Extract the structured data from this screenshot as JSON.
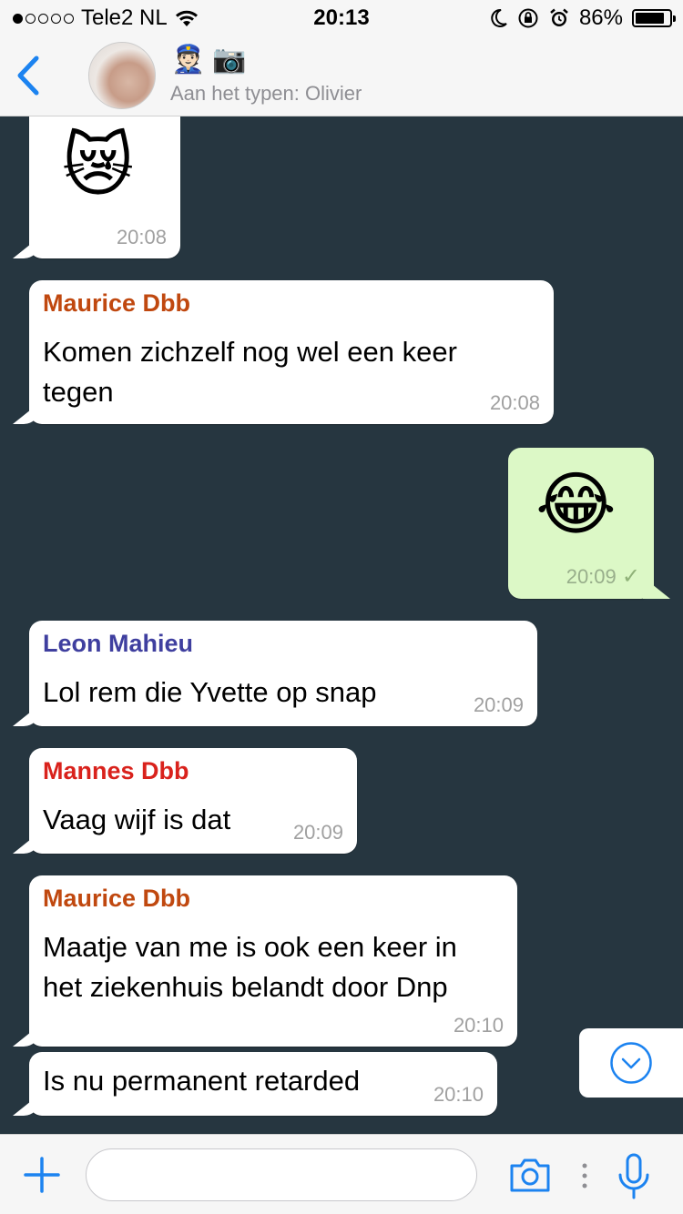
{
  "status_bar": {
    "carrier": "Tele2 NL",
    "time": "20:13",
    "battery": "86%",
    "battery_level": 0.86,
    "signal_bars": 1
  },
  "header": {
    "back_icon": "chevron-left-icon",
    "group_emoji": [
      "👮🏻",
      "📷"
    ],
    "typing_status": "Aan het typen: Olivier"
  },
  "messages": [
    {
      "direction": "in",
      "emoji": "😿",
      "time": "20:08"
    },
    {
      "direction": "in",
      "sender": "Maurice Dbb",
      "sender_color": "#c0480f",
      "text_lines": [
        "Komen zichzelf nog wel een keer",
        "tegen"
      ],
      "time": "20:08"
    },
    {
      "direction": "out",
      "emoji": "😂",
      "time": "20:09",
      "status": "✓"
    },
    {
      "direction": "in",
      "sender": "Leon Mahieu",
      "sender_color": "#3f3f9f",
      "text": "Lol rem die Yvette op snap",
      "time": "20:09"
    },
    {
      "direction": "in",
      "sender": "Mannes Dbb",
      "sender_color": "#d9221c",
      "text": "Vaag wijf is dat",
      "time": "20:09"
    },
    {
      "direction": "in",
      "sender": "Maurice Dbb",
      "sender_color": "#c0480f",
      "text_lines": [
        "Maatje van me is ook een keer in",
        "het ziekenhuis belandt door Dnp"
      ],
      "time": "20:10"
    },
    {
      "direction": "in",
      "text": "Is nu permanent retarded",
      "time": "20:10"
    }
  ],
  "input_bar": {
    "placeholder": "",
    "icons": [
      "plus-icon",
      "camera-icon",
      "more-dots-icon",
      "microphone-icon"
    ]
  },
  "colors": {
    "accent": "#1c83f0",
    "chat_background": "#263640",
    "outgoing_bubble": "#dcf8c6"
  }
}
